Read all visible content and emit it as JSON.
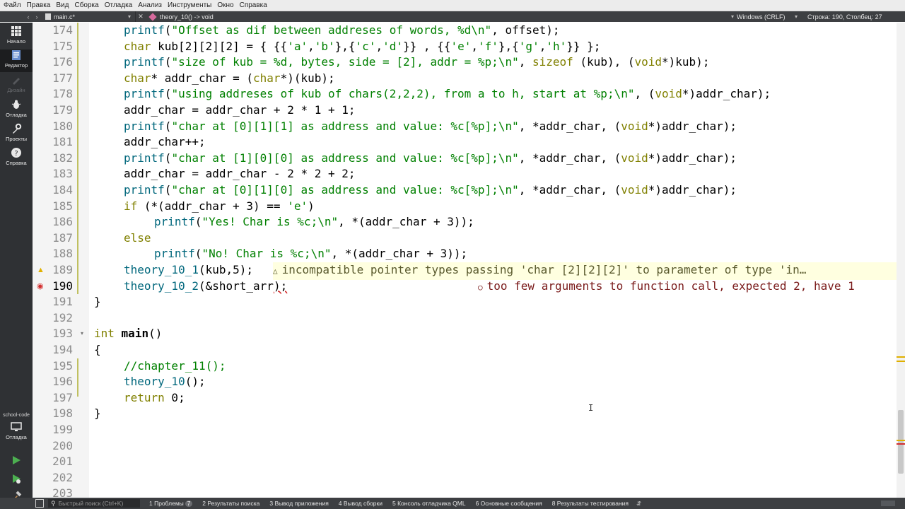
{
  "menu": [
    "Файл",
    "Правка",
    "Вид",
    "Сборка",
    "Отладка",
    "Анализ",
    "Инструменты",
    "Окно",
    "Справка"
  ],
  "docbar": {
    "file_name": "main.c*",
    "symbol": "theory_10() -> void",
    "encoding": "Windows (CRLF)",
    "cursor_pos": "Строка: 190, Столбец: 27"
  },
  "modes": {
    "start": "Начало",
    "editor": "Редактор",
    "design": "Дизайн",
    "debug": "Отладка",
    "projects": "Проекты",
    "help": "Справка",
    "kit": "school-code",
    "target": "Отладка"
  },
  "editor": {
    "lines": [
      {
        "n": "174",
        "code": "printf(\"Offset as dif between addreses of words, %d\\n\", offset);"
      },
      {
        "n": "175",
        "code": "char kub[2][2][2] = { {{'a','b'},{'c','d'}} , {{'e','f'},{'g','h'}} };"
      },
      {
        "n": "176",
        "code": "printf(\"size of kub = %d, bytes, side = [2], addr = %p;\\n\", sizeof (kub), (void*)kub);"
      },
      {
        "n": "177",
        "code": "char* addr_char = (char*)(kub);"
      },
      {
        "n": "178",
        "code": "printf(\"using addreses of kub of chars(2,2,2), from a to h, start at %p;\\n\", (void*)addr_char);"
      },
      {
        "n": "179",
        "code": "addr_char = addr_char + 2 * 1 + 1;"
      },
      {
        "n": "180",
        "code": "printf(\"char at [0][1][1] as address and value: %c[%p];\\n\", *addr_char, (void*)addr_char);"
      },
      {
        "n": "181",
        "code": "addr_char++;"
      },
      {
        "n": "182",
        "code": "printf(\"char at [1][0][0] as address and value: %c[%p];\\n\", *addr_char, (void*)addr_char);"
      },
      {
        "n": "183",
        "code": "addr_char = addr_char - 2 * 2 + 2;"
      },
      {
        "n": "184",
        "code": "printf(\"char at [0][1][0] as address and value: %c[%p];\\n\", *addr_char, (void*)addr_char);"
      },
      {
        "n": "185",
        "code": "if (*(addr_char + 3) == 'e')"
      },
      {
        "n": "186",
        "code": "    printf(\"Yes! Char is %c;\\n\", *(addr_char + 3));"
      },
      {
        "n": "187",
        "code": "else"
      },
      {
        "n": "188",
        "code": "    printf(\"No! Char is %c;\\n\", *(addr_char + 3));"
      },
      {
        "n": "189",
        "code": "theory_10_1(kub,5);"
      },
      {
        "n": "190",
        "code": "theory_10_2(&short_arr);"
      },
      {
        "n": "191",
        "code": "}"
      },
      {
        "n": "192",
        "code": ""
      },
      {
        "n": "193",
        "code": "int main()"
      },
      {
        "n": "194",
        "code": "{"
      },
      {
        "n": "195",
        "code": "//chapter_11();"
      },
      {
        "n": "196",
        "code": "theory_10();"
      },
      {
        "n": "197",
        "code": "return 0;"
      },
      {
        "n": "198",
        "code": "}"
      },
      {
        "n": "199",
        "code": ""
      },
      {
        "n": "200",
        "code": ""
      },
      {
        "n": "201",
        "code": ""
      },
      {
        "n": "202",
        "code": ""
      },
      {
        "n": "203",
        "code": ""
      }
    ],
    "warning_189": "incompatible pointer types passing 'char [2][2][2]' to parameter of type 'in…",
    "error_190": "too few arguments to function call, expected 2, have 1"
  },
  "statusbar": {
    "search_placeholder": "Быстрый поиск (Ctrl+K)",
    "panes": [
      "1 Проблемы",
      "2 Результаты поиска",
      "3 Вывод приложения",
      "4 Вывод сборки",
      "5 Консоль отладчика QML",
      "6 Основные сообщения",
      "8 Результаты тестирования"
    ],
    "problems_count": "7"
  },
  "colors": {
    "keyword": "#808000",
    "string": "#008000",
    "function": "#00677c",
    "warning": "#e0b000",
    "error": "#d32f2f"
  }
}
